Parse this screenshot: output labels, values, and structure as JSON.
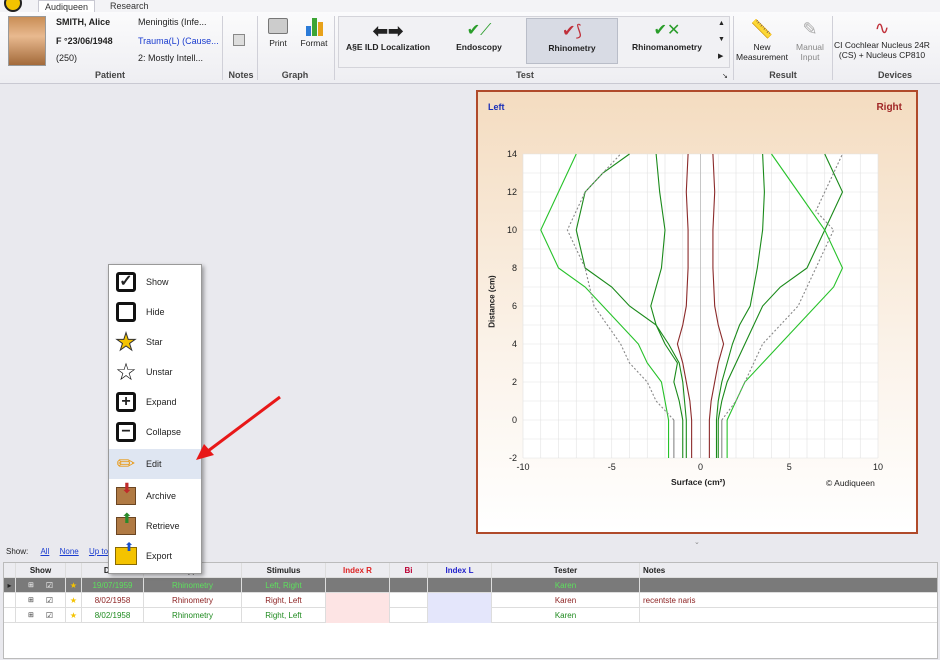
{
  "tabs": [
    "Audiqueen",
    "Research"
  ],
  "patient": {
    "name": "SMITH, Alice",
    "dob": "F °23/06/1948",
    "id": "(250)",
    "cond1": "Meningitis (Infe...",
    "cond2": "Trauma(L) (Cause...",
    "cond3": "2: Mostly Intell...",
    "group": "Patient"
  },
  "notes": {
    "group": "Notes"
  },
  "graph": {
    "print": "Print",
    "format": "Format",
    "group": "Graph"
  },
  "test": {
    "items": [
      "A§E ILD Localization",
      "Endoscopy",
      "Rhinometry",
      "Rhinomanometry"
    ],
    "group": "Test"
  },
  "result": {
    "new": "New Measurement",
    "manual": "Manual Input",
    "group": "Result"
  },
  "devices": {
    "device": "CI Cochlear Nucleus 24R (CS) + Nucleus CP810",
    "group": "Devices"
  },
  "menu": {
    "items": [
      "Show",
      "Hide",
      "Star",
      "Unstar",
      "Expand",
      "Collapse",
      "Edit",
      "Archive",
      "Retrieve",
      "Export"
    ]
  },
  "chart": {
    "left": "Left",
    "right": "Right",
    "ylabel": "Distance (cm)",
    "xlabel": "Surface (cm²)",
    "brand": "© Audiqueen",
    "yticks": [
      "14",
      "12",
      "10",
      "8",
      "6",
      "4",
      "2",
      "0",
      "-2"
    ],
    "xticks": [
      "-10",
      "-5",
      "0",
      "5",
      "10"
    ]
  },
  "chart_data": {
    "type": "line",
    "xlim": [
      -10,
      10
    ],
    "ylim": [
      -2,
      14
    ],
    "xlabel": "Surface (cm²)",
    "ylabel": "Distance (cm)",
    "grid": true,
    "series": [
      {
        "color": "#1a8a1a",
        "x": [
          -1,
          -1.2,
          -1.5,
          -1.3,
          -2,
          -2.5,
          -4,
          -5,
          -6.5,
          -7,
          -6.5,
          -5.5,
          -4
        ],
        "y": [
          0,
          1,
          2,
          3,
          4,
          5,
          6,
          7,
          8,
          10,
          12,
          13,
          14
        ]
      },
      {
        "color": "#27c22a",
        "x": [
          -1.8,
          -2,
          -2.2,
          -3,
          -3.5,
          -4.5,
          -5.5,
          -6.5,
          -8,
          -9,
          -8,
          -7
        ],
        "y": [
          0,
          1,
          2,
          3,
          4,
          5,
          6,
          7,
          8,
          10,
          12,
          14
        ]
      },
      {
        "color": "#1a8a1a",
        "x": [
          -0.8,
          -0.9,
          -1.0,
          -1.2,
          -1.8,
          -2.5,
          -2.8,
          -2.2,
          -2,
          -2.3,
          -2.5
        ],
        "y": [
          0,
          1,
          2,
          3,
          4,
          5,
          6,
          8,
          10,
          12,
          14
        ]
      },
      {
        "color": "#8b2a2a",
        "x": [
          -0.5,
          -0.6,
          -0.8,
          -1.0,
          -1.3,
          -1.0,
          -0.8,
          -0.7,
          -0.7,
          -0.8,
          -0.7
        ],
        "y": [
          0,
          1,
          2,
          3,
          4,
          5,
          6,
          8,
          10,
          12,
          14
        ]
      },
      {
        "color": "#888888",
        "x": [
          -1.5,
          -2.5,
          -3,
          -4,
          -4.5,
          -6,
          -6.5,
          -7.5,
          -6.5,
          -4.5
        ],
        "y": [
          0,
          1,
          2,
          3,
          4,
          6,
          8,
          10,
          12,
          14
        ]
      },
      {
        "color": "#8b2a2a",
        "x": [
          0.5,
          0.6,
          0.8,
          1.0,
          1.3,
          1.0,
          0.8,
          0.7,
          0.7,
          0.8,
          0.7
        ],
        "y": [
          0,
          1,
          2,
          3,
          4,
          5,
          6,
          8,
          10,
          12,
          14
        ]
      },
      {
        "color": "#1a8a1a",
        "x": [
          1,
          1.2,
          1.5,
          2,
          2.5,
          3,
          3.5,
          4.5,
          6,
          7,
          7.5,
          8,
          7
        ],
        "y": [
          0,
          1,
          2,
          3,
          4,
          5,
          6,
          7,
          8,
          10,
          11,
          12,
          14
        ]
      },
      {
        "color": "#27c22a",
        "x": [
          1.5,
          2,
          2.5,
          3.5,
          4.5,
          5.5,
          6.5,
          7.5,
          8,
          7,
          5.5,
          4
        ],
        "y": [
          0,
          1,
          2,
          3,
          4,
          5,
          6,
          7,
          8,
          10,
          12,
          14
        ]
      },
      {
        "color": "#888888",
        "x": [
          1.2,
          2,
          2.5,
          3,
          3.5,
          4.5,
          5.5,
          6.5,
          7.5,
          6.5,
          7,
          8
        ],
        "y": [
          0,
          1,
          2,
          3,
          4,
          5,
          6,
          8,
          10,
          11,
          12,
          14
        ]
      },
      {
        "color": "#1a8a1a",
        "x": [
          0.9,
          1.0,
          1.2,
          1.5,
          1.8,
          2.2,
          2.8,
          3.2,
          3.5,
          3.6,
          3.5
        ],
        "y": [
          0,
          1,
          2,
          3,
          4,
          5,
          6,
          8,
          10,
          12,
          14
        ]
      }
    ]
  },
  "grid": {
    "show_label": "Show:",
    "all": "All",
    "none": "None",
    "upto": "Up to",
    "headers": [
      "Show",
      "Date",
      "Type",
      "Stimulus",
      "Index R",
      "Bi",
      "Index L",
      "Tester",
      "Notes"
    ],
    "rows": [
      {
        "date": "19/07/1959",
        "type": "Rhinometry",
        "stim": "Left, Right",
        "tester": "Karen",
        "notes": ""
      },
      {
        "date": "8/02/1958",
        "type": "Rhinometry",
        "stim": "Right, Left",
        "tester": "Karen",
        "notes": "recentste naris"
      },
      {
        "date": "8/02/1958",
        "type": "Rhinometry",
        "stim": "Right, Left",
        "tester": "Karen",
        "notes": ""
      }
    ]
  }
}
